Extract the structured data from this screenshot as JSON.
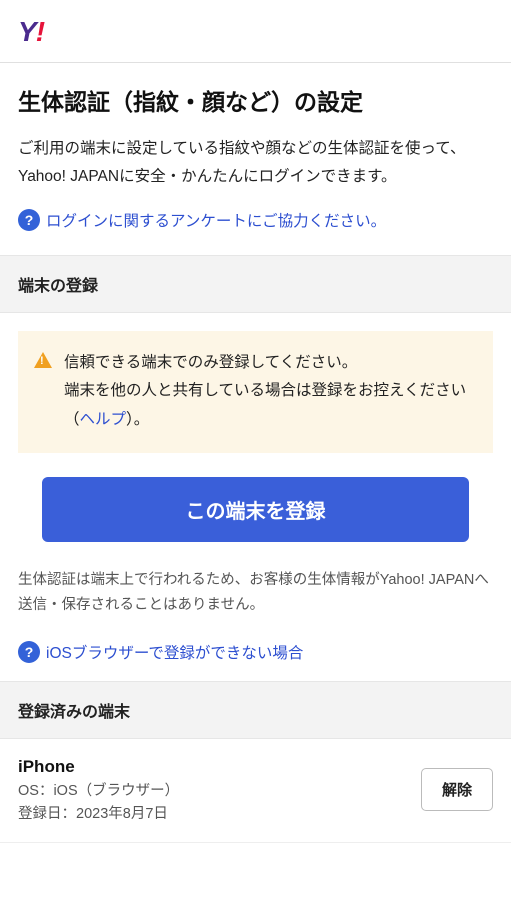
{
  "logo": {
    "part1": "Y",
    "part2": "!"
  },
  "page_title": "生体認証（指紋・顔など）の設定",
  "intro_text": "ご利用の端末に設定している指紋や顔などの生体認証を使って、Yahoo! JAPANに安全・かんたんにログインできます。",
  "survey_link": "ログインに関するアンケートにご協力ください。",
  "register_section": {
    "title": "端末の登録",
    "warning_prefix": "信頼できる端末でのみ登録してください。\n端末を他の人と共有している場合は登録をお控えください（",
    "warning_help": "ヘルプ",
    "warning_suffix": "）。",
    "button": "この端末を登録",
    "note": "生体認証は端末上で行われるため、お客様の生体情報がYahoo! JAPANへ送信・保存されることはありません。",
    "ios_help_link": "iOSブラウザーで登録ができない場合"
  },
  "registered_section": {
    "title": "登録済みの端末",
    "devices": [
      {
        "name": "iPhone",
        "os": "OS：iOS（ブラウザー）",
        "date": "登録日：2023年8月7日"
      }
    ],
    "remove_label": "解除"
  }
}
